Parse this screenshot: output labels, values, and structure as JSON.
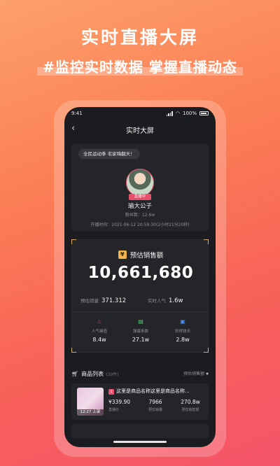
{
  "promo": {
    "headline": "实时直播大屏",
    "subline": "#监控实时数据 掌握直播动态"
  },
  "status": {
    "time": "9:41",
    "battery": "100%"
  },
  "nav": {
    "back_icon": "‹",
    "title": "实时大屏"
  },
  "profile": {
    "notice": "全民运动季 宅家嗨翻天！",
    "live_badge": "直播中",
    "name": "瑜大公子",
    "fans": "粉丝数：12.6w",
    "airtime": "开播时间：2021-06-12 20:59:30(2小时21分20秒)"
  },
  "sales": {
    "label": "预估销售额",
    "value": "10,661,680",
    "est_volume_label": "预估销量",
    "est_volume_value": "371.312",
    "popularity_label": "实时人气",
    "popularity_value": "1.6w",
    "stats": [
      {
        "icon": "flame-icon",
        "label": "人气峰值",
        "value": "8.4w"
      },
      {
        "icon": "chat-icon",
        "label": "弹幕条数",
        "value": "27.1w"
      },
      {
        "icon": "ticket-icon",
        "label": "获得钱币",
        "value": "2.8w"
      }
    ]
  },
  "product_list": {
    "title": "商品列表",
    "count": "(39件)",
    "sort_label": "预估销售额",
    "items": [
      {
        "thumb_time": "12:27 上架",
        "name": "这里是商品名称这里是商品名称...",
        "price": "¥339.90",
        "price_label": "直播价",
        "volume": "7966",
        "volume_label": "预估销量",
        "revenue": "270.8w",
        "revenue_label": "预估销售额"
      }
    ]
  },
  "colors": {
    "accent": "#e8506c",
    "gold": "#d6a96a",
    "card_bg": "#242529",
    "screen_bg": "#1b1c1f"
  }
}
